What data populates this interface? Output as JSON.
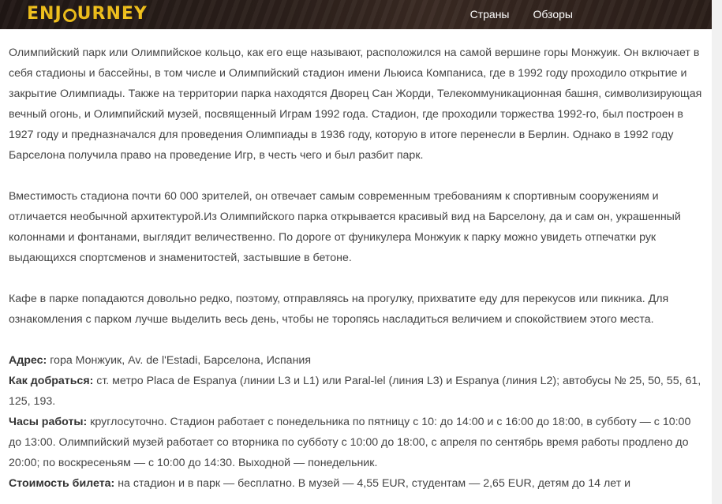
{
  "header": {
    "logo": {
      "part1": "ENJ",
      "part2": "URNEY"
    },
    "nav": [
      {
        "label": "Страны"
      },
      {
        "label": "Обзоры"
      }
    ]
  },
  "article": {
    "p1": "Олимпийский парк или Олимпийское кольцо, как его еще называют, расположился на самой вершине горы Монжуик. Он включает в себя стадионы и бассейны, в том числе и Олимпийский стадион имени Льюиса Компаниса, где в 1992 году проходило открытие и закрытие Олимпиады. Также на территории парка находятся Дворец Сан Жорди, Телекоммуникационная башня, символизирующая вечный огонь, и Олимпийский музей, посвященный Играм 1992 года. Стадион, где проходили торжества 1992-го, был построен в 1927 году и предназначался для проведения Олимпиады в 1936 году, которую в итоге перенесли в Берлин. Однако в 1992 году Барселона получила право на проведение Игр, в честь чего и был разбит парк.",
    "p2": "Вместимость стадиона почти 60 000 зрителей, он отвечает самым современным требованиям к спортивным сооружениям и отличается необычной архитектурой.Из Олимпийского парка открывается красивый вид на Барселону, да и сам он, украшенный колоннами и фонтанами, выглядит величественно. По дороге от фуникулера Монжуик к парку можно увидеть отпечатки рук выдающихся спортсменов и знаменитостей, застывшие в бетоне.",
    "p3": "Кафе в парке попадаются довольно редко, поэтому, отправляясь на прогулку, прихватите еду для перекусов или пикника. Для ознакомления с парком лучше выделить весь день, чтобы не торопясь насладиться величием и спокойствием этого места.",
    "info": {
      "address": {
        "label": "Адрес:",
        "value": " гора Монжуик, Av. de l'Estadi, Барселона, Испания"
      },
      "directions": {
        "label": "Как добраться:",
        "value": " ст. метро Placa de Espanya (линии L3 и L1) или Paral-lel (линия L3) и Espanya (линия L2); автобусы № 25, 50, 55, 61, 125, 193."
      },
      "hours": {
        "label": "Часы работы:",
        "value": " круглосуточно. Стадион работает с понедельника по пятницу с 10: до 14:00 и с 16:00 до 18:00, в субботу — с 10:00 до 13:00. Олимпийский музей работает со вторника по субботу с 10:00 до 18:00, с апреля по сентябрь время работы продлено до 20:00; по воскресеньям — с 10:00 до 14:30. Выходной — понедельник."
      },
      "price": {
        "label": "Стоимость билета:",
        "value": " на стадион и в парк — бесплатно. В музей — 4,55 EUR, студентам — 2,65 EUR, детям до 14 лет и"
      }
    }
  }
}
